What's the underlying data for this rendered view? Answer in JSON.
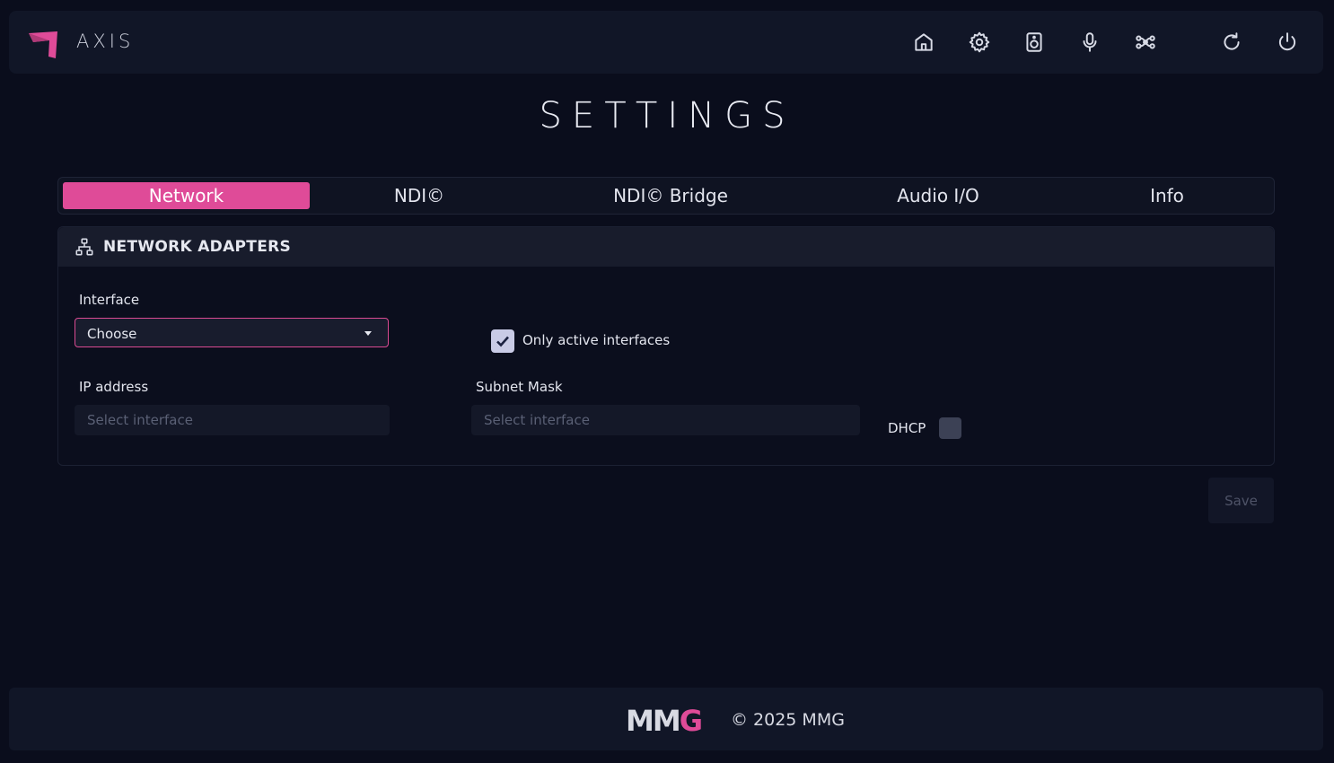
{
  "app": {
    "brand": "AXIS"
  },
  "nav": {
    "icons": [
      "home-icon",
      "settings-icon",
      "speaker-icon",
      "microphone-icon",
      "routing-icon",
      "refresh-icon",
      "power-icon"
    ]
  },
  "page": {
    "title": "SETTINGS"
  },
  "tabs": [
    {
      "label": "Network",
      "active": true
    },
    {
      "label": "NDI©",
      "active": false
    },
    {
      "label": "NDI© Bridge",
      "active": false
    },
    {
      "label": "Audio I/O",
      "active": false
    },
    {
      "label": "Info",
      "active": false
    }
  ],
  "section": {
    "title": "NETWORK ADAPTERS",
    "icon": "network-icon",
    "interface_label": "Interface",
    "interface_value": "Choose",
    "only_active_label": "Only active interfaces",
    "only_active_checked": true,
    "ip_label": "IP address",
    "ip_placeholder": "Select interface",
    "subnet_label": "Subnet Mask",
    "subnet_placeholder": "Select interface",
    "dhcp_label": "DHCP",
    "dhcp_checked": false
  },
  "actions": {
    "save_label": "Save"
  },
  "footer": {
    "logo_text": "MM",
    "logo_accent": "G",
    "copyright": "© 2025 MMG"
  },
  "colors": {
    "accent": "#df4b98",
    "background": "#0a0d1c",
    "panel": "#111627"
  }
}
